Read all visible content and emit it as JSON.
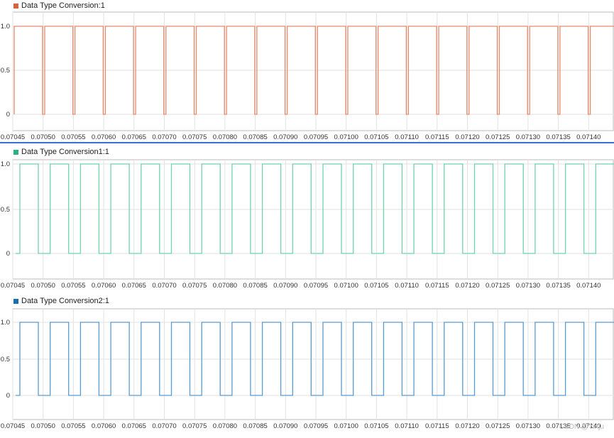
{
  "panels": [
    {
      "legend": "Data Type Conversion:1",
      "color": "#d9623b",
      "line_color": "#e48a6c",
      "phase": "high_first"
    },
    {
      "legend": "Data Type Conversion1:1",
      "color": "#2eb07e",
      "line_color": "#6fd3ad",
      "phase": "low_first"
    },
    {
      "legend": "Data Type Conversion2:1",
      "color": "#1a6fb0",
      "line_color": "#5a9bd0",
      "phase": "low_first"
    }
  ],
  "y_ticks": [
    "1.0",
    "0.5",
    "0"
  ],
  "x_ticks": [
    "0.07045",
    "0.07050",
    "0.07055",
    "0.07060",
    "0.07065",
    "0.07070",
    "0.07075",
    "0.07080",
    "0.07085",
    "0.07090",
    "0.07095",
    "0.07100",
    "0.07105",
    "0.07110",
    "0.07115",
    "0.07120",
    "0.07125",
    "0.07130",
    "0.07135",
    "0.07140"
  ],
  "chart_data": [
    {
      "type": "line",
      "title": "",
      "series": [
        {
          "name": "Data Type Conversion:1",
          "description": "square wave, high ~1.0 with short low dips to 0 roughly every 0.00005 s"
        }
      ],
      "xlim": [
        0.07045,
        0.07146
      ],
      "ylim": [
        -0.25,
        1.1
      ],
      "grid": true
    },
    {
      "type": "line",
      "title": "",
      "series": [
        {
          "name": "Data Type Conversion1:1",
          "description": "square wave between 0 and 1.0, period ~0.00005 s"
        }
      ],
      "xlim": [
        0.07045,
        0.07146
      ],
      "ylim": [
        -0.25,
        1.1
      ],
      "grid": true
    },
    {
      "type": "line",
      "title": "",
      "series": [
        {
          "name": "Data Type Conversion2:1",
          "description": "square wave between 0 and 1.0, period ~0.00005 s"
        }
      ],
      "xlim": [
        0.07045,
        0.07146
      ],
      "ylim": [
        -0.25,
        1.1
      ],
      "grid": true
    }
  ],
  "watermark": "CSDN @Yinju"
}
